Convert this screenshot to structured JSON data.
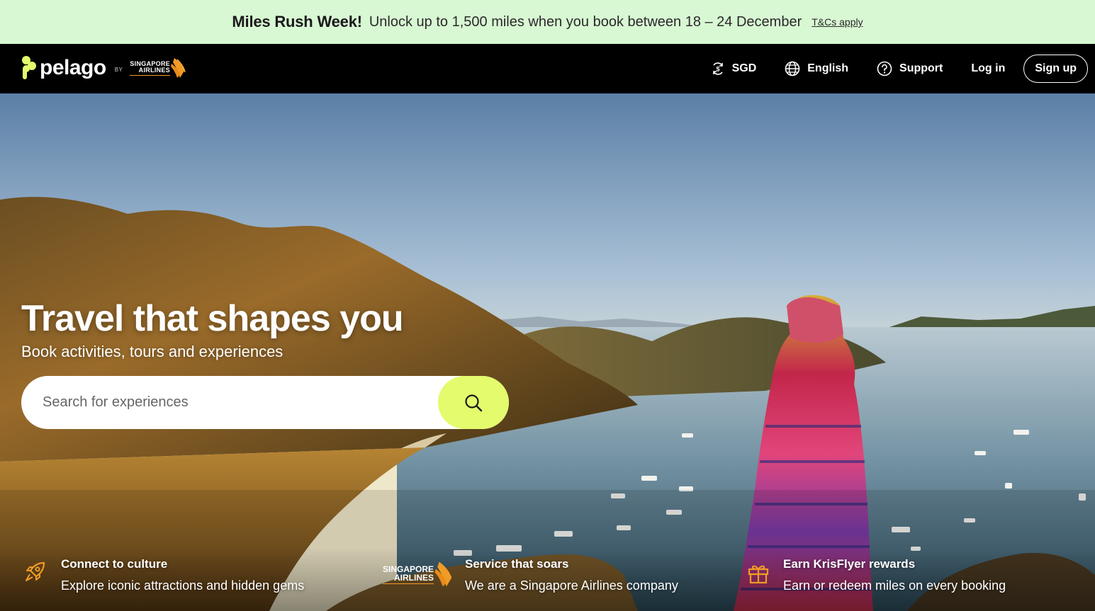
{
  "promo": {
    "title": "Miles Rush Week!",
    "text": "Unlock up to 1,500 miles when you book between 18 – 24 December",
    "link": "T&Cs apply",
    "bg_color": "#d8f7d3"
  },
  "header": {
    "brand": "pelago",
    "brand_by": "BY",
    "partner_line1": "SINGAPORE",
    "partner_line2": "AIRLINES",
    "currency": "SGD",
    "language": "English",
    "support": "Support",
    "login": "Log in",
    "signup": "Sign up",
    "icons": [
      "currency-icon",
      "globe-icon",
      "help-icon"
    ]
  },
  "hero": {
    "title": "Travel that shapes you",
    "subtitle": "Book activities, tours and experiences",
    "search_placeholder": "Search for experiences",
    "search_icon": "search-icon",
    "accent_color": "#e3fb6d"
  },
  "features": [
    {
      "icon": "rocket-icon",
      "title": "Connect to culture",
      "desc": "Explore iconic attractions and hidden gems"
    },
    {
      "icon": "singapore-airlines-logo",
      "logo_line1": "SINGAPORE",
      "logo_line2": "AIRLINES",
      "title": "Service that soars",
      "desc": "We are a Singapore Airlines company"
    },
    {
      "icon": "gift-icon",
      "title": "Earn KrisFlyer rewards",
      "desc": "Earn or redeem miles on every booking"
    }
  ]
}
